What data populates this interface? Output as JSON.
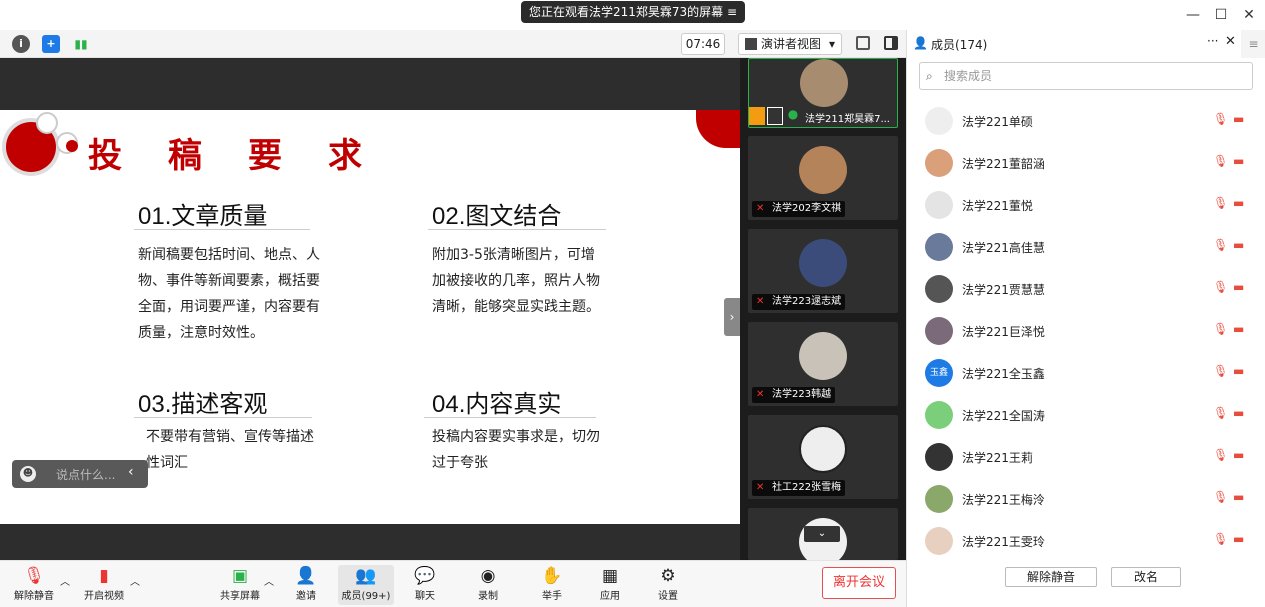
{
  "banner": {
    "text": "您正在观看法学211郑昊霖73的屏幕",
    "menu_icon": "≡"
  },
  "window": {
    "minimize": "—",
    "maximize": "☐",
    "close": "✕"
  },
  "toolbar": {
    "timer": "07:46",
    "view_label": "演讲者视图",
    "view_caret": "▾"
  },
  "slide": {
    "heading": "投　稿　要　求",
    "s1": {
      "title": "01.文章质量",
      "body": "新闻稿要包括时间、地点、人物、事件等新闻要素，概括要全面，用词要严谨，内容要有质量，注意时效性。"
    },
    "s2": {
      "title": "02.图文结合",
      "body": "附加3-5张清晰图片，可增加被接收的几率，照片人物清晰，能够突显实践主题。"
    },
    "s3": {
      "title": "03.描述客观",
      "body": "不要带有营销、宣传等描述性词汇"
    },
    "s4": {
      "title": "04.内容真实",
      "body": "投稿内容要实事求是，切勿过于夸张"
    }
  },
  "chat_input": {
    "placeholder": "说点什么..."
  },
  "tiles": [
    "法学211郑昊霖7...",
    "法学202李文祺",
    "法学223逯志斌",
    "法学223韩越",
    "社工222张雪梅"
  ],
  "panel": {
    "title": "成员(174)",
    "more": "···",
    "close": "✕",
    "search_placeholder": "搜索成员",
    "members": [
      "法学221单硕",
      "法学221董韶涵",
      "法学221董悦",
      "法学221高佳慧",
      "法学221贾慧慧",
      "法学221巨泽悦",
      "法学221全玉鑫",
      "法学221全国涛",
      "法学221王莉",
      "法学221王梅泠",
      "法学221王雯玲"
    ],
    "avatar_text_7": "玉鑫",
    "unmute_btn": "解除静音",
    "rename_btn": "改名"
  },
  "bottom": {
    "mute": "解除静音",
    "video": "开启视频",
    "share": "共享屏幕",
    "invite": "邀请",
    "members": "成员(99+)",
    "chat": "聊天",
    "record": "录制",
    "hand": "举手",
    "apps": "应用",
    "settings": "设置",
    "leave": "离开会议"
  },
  "colors": {
    "accent": "#c00000",
    "muted": "#e74c3c",
    "blue": "#1e7be6"
  }
}
